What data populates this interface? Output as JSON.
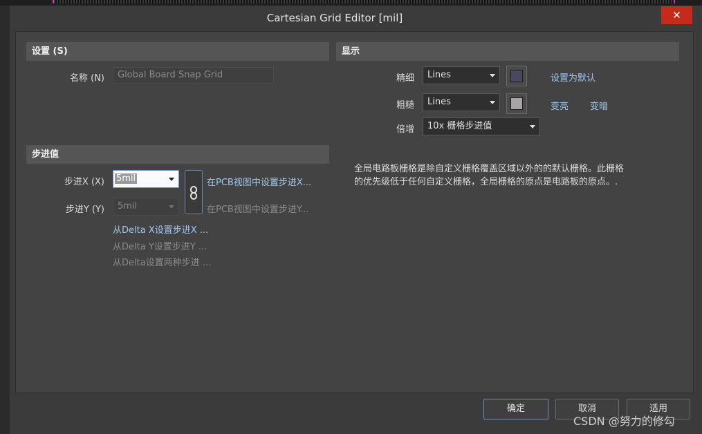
{
  "window": {
    "title": "Cartesian Grid Editor [mil]",
    "close_glyph": "✕"
  },
  "settings": {
    "header": "设置 (S)",
    "name_label": "名称 (N)",
    "name_value": "Global Board Snap Grid"
  },
  "step": {
    "header": "步进值",
    "x_label": "步进X (X)",
    "x_value": "5mil",
    "y_label": "步进Y (Y)",
    "y_value": "5mil",
    "x_link": "在PCB视图中设置步进X...",
    "y_link": "在PCB视图中设置步进Y...",
    "from_delta_x": "从Delta X设置步进X ...",
    "from_delta_y": "从Delta Y设置步进Y ...",
    "from_delta_both": "从Delta设置两种步进 ..."
  },
  "display": {
    "header": "显示",
    "fine_label": "精细",
    "fine_value": "Lines",
    "coarse_label": "粗糙",
    "coarse_value": "Lines",
    "multiplier_label": "倍增",
    "multiplier_value": "10x 栅格步进值",
    "set_default": "设置为默认",
    "lighter": "变亮",
    "darker": "变暗",
    "description_line1": "全局电路板栅格是除自定义栅格覆盖区域以外的的默认栅格。此栅格",
    "description_line2": "的优先级低于任何自定义栅格，全局栅格的原点是电路板的原点。.",
    "fine_color": "#484860",
    "coarse_color": "#a8a4a8"
  },
  "footer": {
    "ok": "确定",
    "cancel": "取消",
    "apply": "适用"
  },
  "watermark": "CSDN @努力的修勾"
}
